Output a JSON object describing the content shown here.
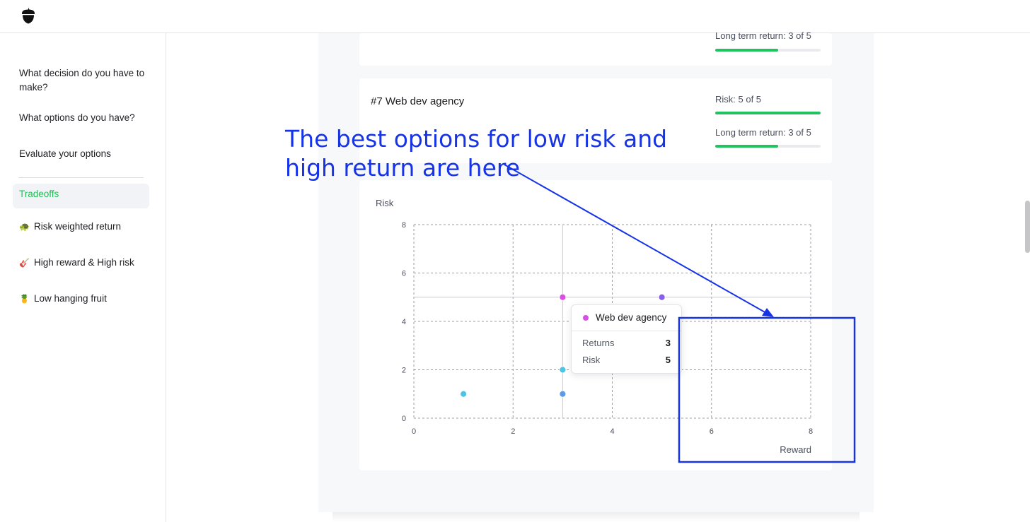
{
  "app": {
    "logo_icon": "acorn-icon"
  },
  "sidebar": {
    "items": [
      {
        "label": "What decision do you have to make?"
      },
      {
        "label": "What options do you have?"
      },
      {
        "label": "Evaluate your options"
      }
    ],
    "active": {
      "label": "Tradeoffs"
    },
    "sub_items": [
      {
        "emoji": "🐢",
        "label": "Risk weighted return"
      },
      {
        "emoji": "🎸",
        "label": "High reward & High risk"
      },
      {
        "emoji": "🍍",
        "label": "Low hanging fruit"
      }
    ]
  },
  "prev_card": {
    "return_label": "Long term return: 3 of 5",
    "return_value": 3,
    "return_max": 5
  },
  "option_card": {
    "title": "#7 Web dev agency",
    "risk_label": "Risk: 5 of 5",
    "risk_value": 5,
    "risk_max": 5,
    "return_label": "Long term return: 3 of 5",
    "return_value": 3,
    "return_max": 5
  },
  "chart_data": {
    "type": "scatter",
    "title": "",
    "xlabel": "Reward",
    "ylabel": "Risk",
    "xlim": [
      0,
      8
    ],
    "ylim": [
      0,
      8
    ],
    "x_ticks": [
      0,
      2,
      4,
      6,
      8
    ],
    "y_ticks": [
      0,
      2,
      4,
      6,
      8
    ],
    "grid": true,
    "points": [
      {
        "x": 1,
        "y": 1,
        "color": "#4ec3e6"
      },
      {
        "x": 3,
        "y": 1,
        "color": "#5b9bea"
      },
      {
        "x": 3,
        "y": 2,
        "color": "#4ec3e6"
      },
      {
        "x": 3,
        "y": 5,
        "color": "#d94fe6"
      },
      {
        "x": 5,
        "y": 5,
        "color": "#8a5fe8"
      }
    ],
    "highlight": {
      "x": 3,
      "y": 5
    }
  },
  "tooltip": {
    "title": "Web dev agency",
    "dot_color": "#d94fe6",
    "rows": [
      {
        "label": "Returns",
        "value": "3"
      },
      {
        "label": "Risk",
        "value": "5"
      }
    ]
  },
  "annotation": {
    "text": "The best options for low risk and high return are here",
    "color": "#1733e6"
  }
}
